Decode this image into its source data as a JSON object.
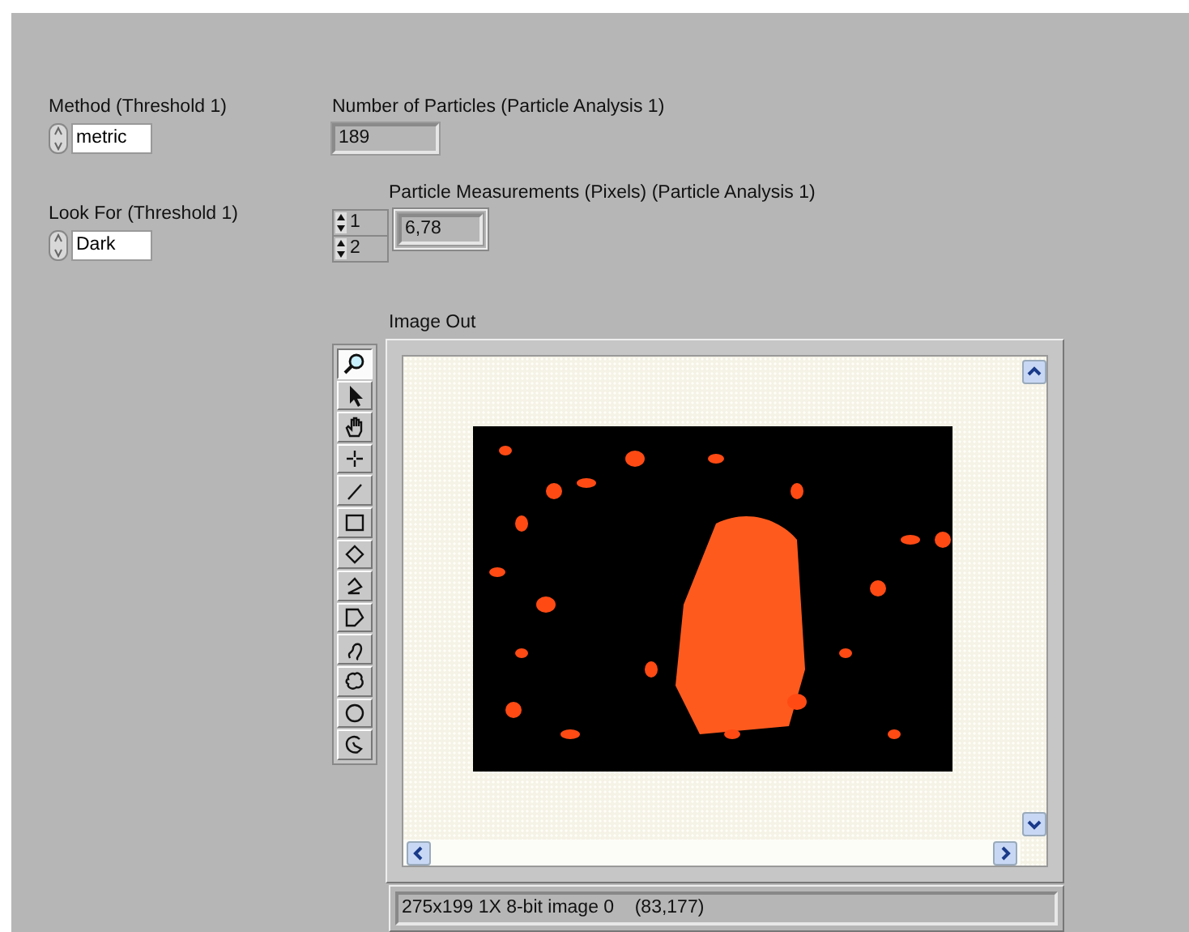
{
  "controls": [
    {
      "label": "Method (Threshold 1)",
      "value": "metric"
    },
    {
      "label": "Look For (Threshold 1)",
      "value": "Dark"
    }
  ],
  "number_of_particles": {
    "label": "Number of Particles (Particle Analysis 1)",
    "value": "189"
  },
  "particle_measurements": {
    "label": "Particle Measurements (Pixels) (Particle Analysis 1)",
    "indices": [
      "1",
      "2"
    ],
    "value": "6,78"
  },
  "image_out": {
    "label": "Image Out",
    "tools": [
      {
        "kind": "zoom",
        "selected": true
      },
      {
        "kind": "pointer",
        "selected": false
      },
      {
        "kind": "pan",
        "selected": false
      },
      {
        "kind": "point",
        "selected": false
      },
      {
        "kind": "line",
        "selected": false
      },
      {
        "kind": "rectangle",
        "selected": false
      },
      {
        "kind": "rotated-rectangle",
        "selected": false
      },
      {
        "kind": "broken-line",
        "selected": false
      },
      {
        "kind": "polygon",
        "selected": false
      },
      {
        "kind": "freehand-line",
        "selected": false
      },
      {
        "kind": "freehand-region",
        "selected": false
      },
      {
        "kind": "oval",
        "selected": false
      },
      {
        "kind": "annulus",
        "selected": false
      }
    ],
    "status": "275x199 1X 8-bit image 0    (83,177)"
  }
}
